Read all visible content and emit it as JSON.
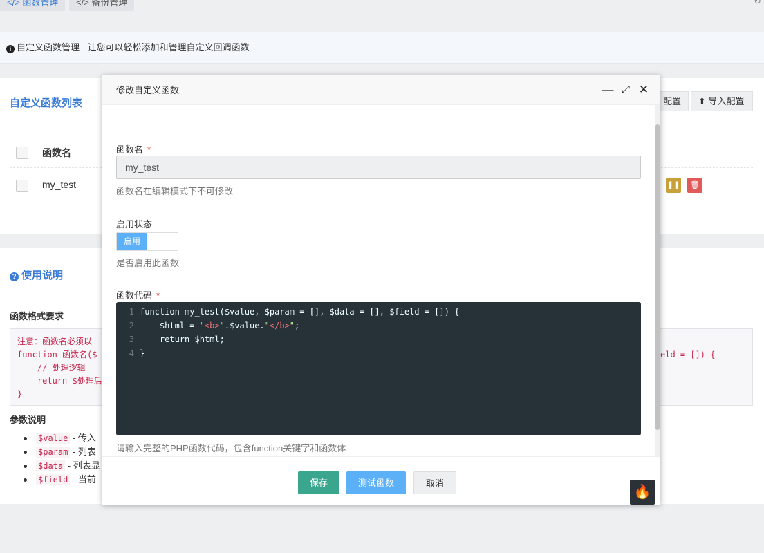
{
  "tabs": [
    {
      "label": "</> 函数管理"
    },
    {
      "label": "</> 备份管理"
    }
  ],
  "info_bar": {
    "text": "自定义函数管理 - 让您可以轻松添加和管理自定义回调函数"
  },
  "list_panel": {
    "title": "自定义函数列表",
    "export_label": "配置",
    "import_label": "导入配置",
    "column_name": "函数名",
    "rows": [
      {
        "name": "my_test"
      }
    ]
  },
  "usage": {
    "title": "使用说明",
    "format_title": "函数格式要求",
    "code_lines": [
      "注意：函数名必须以",
      "function 函数名($",
      "    // 处理逻辑",
      "    return $处理后",
      "}"
    ],
    "code_right": "eld = []) {",
    "params_title": "参数说明",
    "params": [
      {
        "code": "$value",
        "desc": "- 传入"
      },
      {
        "code": "$param",
        "desc": "- 列表"
      },
      {
        "code": "$data",
        "desc": "- 列表显"
      },
      {
        "code": "$field",
        "desc": "- 当前"
      }
    ]
  },
  "modal": {
    "title": "修改自定义函数",
    "name_label": "函数名",
    "name_value": "my_test",
    "name_help": "函数名在编辑模式下不可修改",
    "status_label": "启用状态",
    "status_on_text": "启用",
    "status_help": "是否启用此函数",
    "code_label": "函数代码",
    "code_lines": [
      {
        "num": "1",
        "parts": [
          [
            "t",
            "function my_test($value, $param = [], $data = [], $field = []) {"
          ]
        ]
      },
      {
        "num": "2",
        "parts": [
          [
            "t",
            "    $html = "
          ],
          [
            "s",
            "\""
          ],
          [
            "g",
            "<b>"
          ],
          [
            "s",
            "\""
          ],
          [
            "t",
            ".$value."
          ],
          [
            "s",
            "\""
          ],
          [
            "g",
            "</b>"
          ],
          [
            "s",
            "\""
          ],
          [
            "t",
            ";"
          ]
        ]
      },
      {
        "num": "3",
        "parts": [
          [
            "t",
            "    return $html;"
          ]
        ]
      },
      {
        "num": "4",
        "parts": [
          [
            "t",
            "}"
          ]
        ]
      }
    ],
    "code_help": "请输入完整的PHP函数代码，包含function关键字和函数体",
    "save_label": "保存",
    "test_label": "测试函数",
    "cancel_label": "取消",
    "colors": {
      "save": "#3aa68d",
      "test": "#5bb0f7",
      "cancel": "#eeeff1"
    }
  },
  "icons": [
    "info-icon",
    "refresh-icon",
    "question-icon",
    "minimize-icon",
    "maximize-icon",
    "close-icon",
    "flame-icon",
    "upload-icon",
    "pause-icon",
    "trash-icon"
  ]
}
